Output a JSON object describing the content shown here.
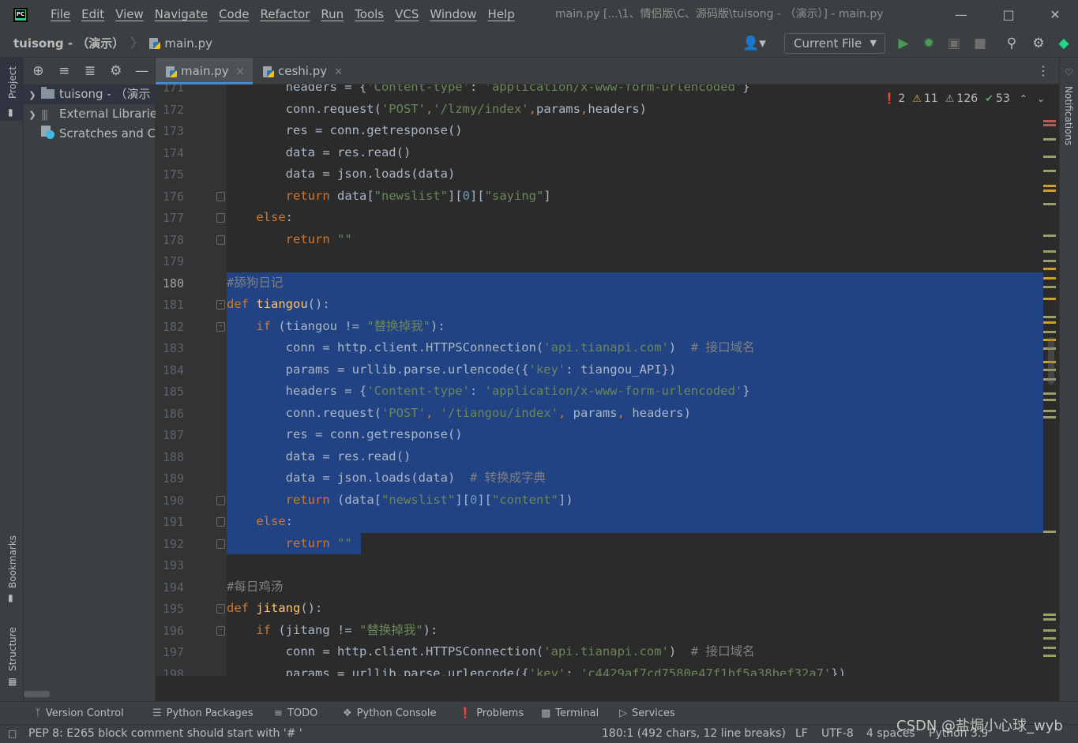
{
  "titlebar": {
    "menu": [
      "File",
      "Edit",
      "View",
      "Navigate",
      "Code",
      "Refactor",
      "Run",
      "Tools",
      "VCS",
      "Window",
      "Help"
    ],
    "window_title": "main.py [...\\1、情侣版\\C、源码版\\tuisong - （演示）] - main.py"
  },
  "navbar": {
    "project": "tuisong - （演示）",
    "file": "main.py",
    "run_config": "Current File"
  },
  "left_strip": {
    "project_tab": "Project",
    "bookmarks_tab": "Bookmarks",
    "structure_tab": "Structure"
  },
  "right_strip": {
    "notifications_tab": "Notifications"
  },
  "project_tree": [
    {
      "label": "tuisong - （演示",
      "kind": "folder",
      "expandable": true
    },
    {
      "label": "External Librarie",
      "kind": "library",
      "expandable": true
    },
    {
      "label": "Scratches and C",
      "kind": "scratch",
      "expandable": false
    }
  ],
  "tabs": [
    {
      "label": "main.py",
      "active": true
    },
    {
      "label": "ceshi.py",
      "active": false
    }
  ],
  "inspections": {
    "errors": "2",
    "warnings": "11",
    "weak_warnings": "126",
    "typos": "53"
  },
  "editor": {
    "current_line": 180,
    "line_numbers": [
      "171",
      "172",
      "173",
      "174",
      "175",
      "176",
      "177",
      "178",
      "179",
      "180",
      "181",
      "182",
      "183",
      "184",
      "185",
      "186",
      "187",
      "188",
      "189",
      "190",
      "191",
      "192",
      "193",
      "194",
      "195",
      "196",
      "197",
      "198"
    ],
    "code": [
      "        headers = {'Content-type': 'application/x-www-form-urlencoded'}",
      "        conn.request('POST','/lzmy/index',params,headers)",
      "        res = conn.getresponse()",
      "        data = res.read()",
      "        data = json.loads(data)",
      "        return data[\"newslist\"][0][\"saying\"]",
      "    else:",
      "        return \"\"",
      "",
      "#舔狗日记",
      "def tiangou():",
      "    if (tiangou != \"替换掉我\"):",
      "        conn = http.client.HTTPSConnection('api.tianapi.com')  # 接口域名",
      "        params = urllib.parse.urlencode({'key': tiangou_API})",
      "        headers = {'Content-type': 'application/x-www-form-urlencoded'}",
      "        conn.request('POST', '/tiangou/index', params, headers)",
      "        res = conn.getresponse()",
      "        data = res.read()",
      "        data = json.loads(data)  # 转换成字典",
      "        return (data[\"newslist\"][0][\"content\"])",
      "    else:",
      "        return \"\"",
      "",
      "#每日鸡汤",
      "def jitang():",
      "    if (jitang != \"替换掉我\"):",
      "        conn = http.client.HTTPSConnection('api.tianapi.com')  # 接口域名",
      "        params = urllib.parse.urlencode({'key': 'c4429af7cd7580e47f1bf5a38bef32a7'})"
    ]
  },
  "bottom_tools": [
    "Version Control",
    "Python Packages",
    "TODO",
    "Python Console",
    "Problems",
    "Terminal",
    "Services"
  ],
  "statusbar": {
    "message": "PEP 8: E265 block comment should start with '# '",
    "position": "180:1 (492 chars, 12 line breaks)",
    "line_sep": "LF",
    "encoding": "UTF-8",
    "indent": "4 spaces",
    "interpreter": "Python 3.9"
  },
  "watermark": "CSDN @盐焗小心球_wyb"
}
